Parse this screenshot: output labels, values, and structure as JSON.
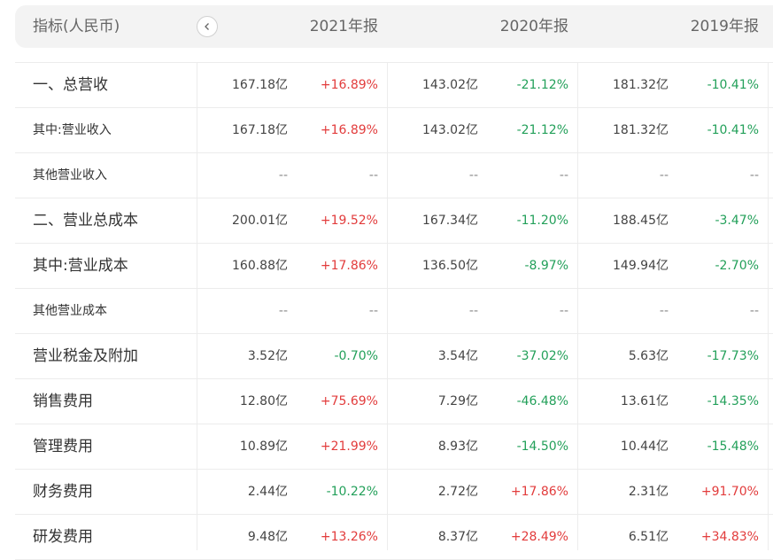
{
  "header": {
    "label": "指标(人民币)",
    "years": [
      "2021年报",
      "2020年报",
      "2019年报"
    ]
  },
  "rows": [
    {
      "label": "一、总营收",
      "level": 1,
      "cells": [
        [
          "167.18亿",
          "+16.89%"
        ],
        [
          "143.02亿",
          "-21.12%"
        ],
        [
          "181.32亿",
          "-10.41%"
        ]
      ]
    },
    {
      "label": "其中:营业收入",
      "level": 2,
      "cells": [
        [
          "167.18亿",
          "+16.89%"
        ],
        [
          "143.02亿",
          "-21.12%"
        ],
        [
          "181.32亿",
          "-10.41%"
        ]
      ]
    },
    {
      "label": "其他营业收入",
      "level": 2,
      "cells": [
        [
          "--",
          "--"
        ],
        [
          "--",
          "--"
        ],
        [
          "--",
          "--"
        ]
      ]
    },
    {
      "label": "二、营业总成本",
      "level": 1,
      "cells": [
        [
          "200.01亿",
          "+19.52%"
        ],
        [
          "167.34亿",
          "-11.20%"
        ],
        [
          "188.45亿",
          "-3.47%"
        ]
      ]
    },
    {
      "label": "其中:营业成本",
      "level": 1,
      "cells": [
        [
          "160.88亿",
          "+17.86%"
        ],
        [
          "136.50亿",
          "-8.97%"
        ],
        [
          "149.94亿",
          "-2.70%"
        ]
      ]
    },
    {
      "label": "其他营业成本",
      "level": 2,
      "cells": [
        [
          "--",
          "--"
        ],
        [
          "--",
          "--"
        ],
        [
          "--",
          "--"
        ]
      ]
    },
    {
      "label": "营业税金及附加",
      "level": 1,
      "cells": [
        [
          "3.52亿",
          "-0.70%"
        ],
        [
          "3.54亿",
          "-37.02%"
        ],
        [
          "5.63亿",
          "-17.73%"
        ]
      ]
    },
    {
      "label": "销售费用",
      "level": 1,
      "cells": [
        [
          "12.80亿",
          "+75.69%"
        ],
        [
          "7.29亿",
          "-46.48%"
        ],
        [
          "13.61亿",
          "-14.35%"
        ]
      ]
    },
    {
      "label": "管理费用",
      "level": 1,
      "cells": [
        [
          "10.89亿",
          "+21.99%"
        ],
        [
          "8.93亿",
          "-14.50%"
        ],
        [
          "10.44亿",
          "-15.48%"
        ]
      ]
    },
    {
      "label": "财务费用",
      "level": 1,
      "cells": [
        [
          "2.44亿",
          "-10.22%"
        ],
        [
          "2.72亿",
          "+17.86%"
        ],
        [
          "2.31亿",
          "+91.70%"
        ]
      ]
    },
    {
      "label": "研发费用",
      "level": 1,
      "cells": [
        [
          "9.48亿",
          "+13.26%"
        ],
        [
          "8.37亿",
          "+28.49%"
        ],
        [
          "6.51亿",
          "+34.83%"
        ]
      ]
    }
  ],
  "colors": {
    "increase": "#e23c3c",
    "decrease": "#23a05a",
    "header_bg": "#f3f3f3"
  },
  "icons": {
    "back": "chevron-left-icon"
  }
}
